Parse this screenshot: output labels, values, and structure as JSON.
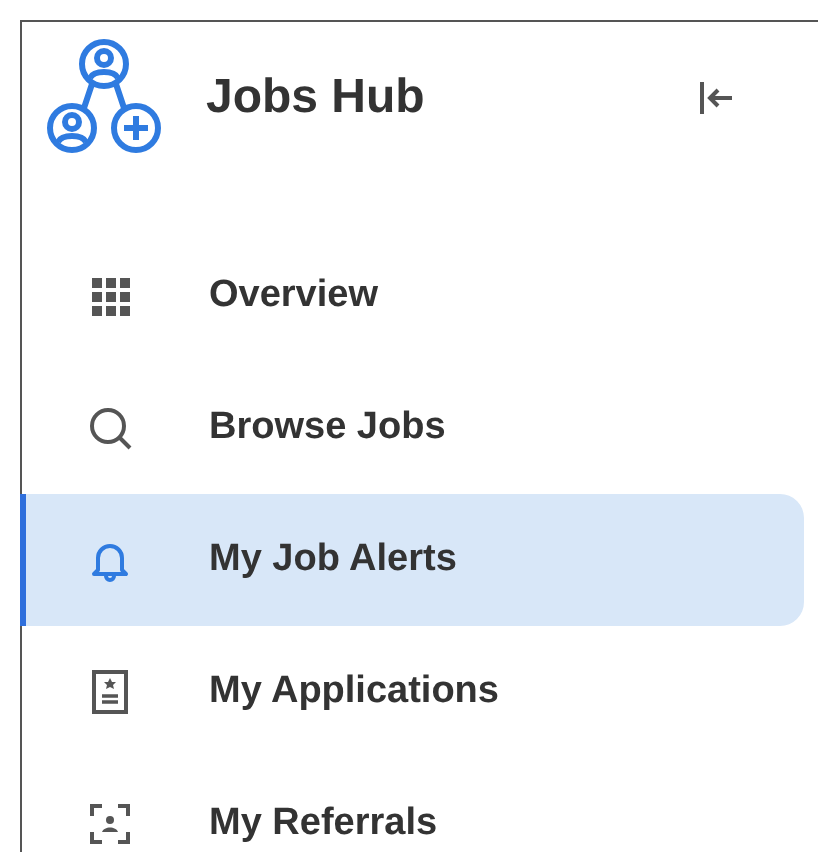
{
  "header": {
    "title": "Jobs Hub"
  },
  "nav_items": [
    {
      "label": "Overview",
      "selected": false
    },
    {
      "label": "Browse Jobs",
      "selected": false
    },
    {
      "label": "My Job Alerts",
      "selected": true
    },
    {
      "label": "My Applications",
      "selected": false
    },
    {
      "label": "My Referrals",
      "selected": false
    }
  ]
}
